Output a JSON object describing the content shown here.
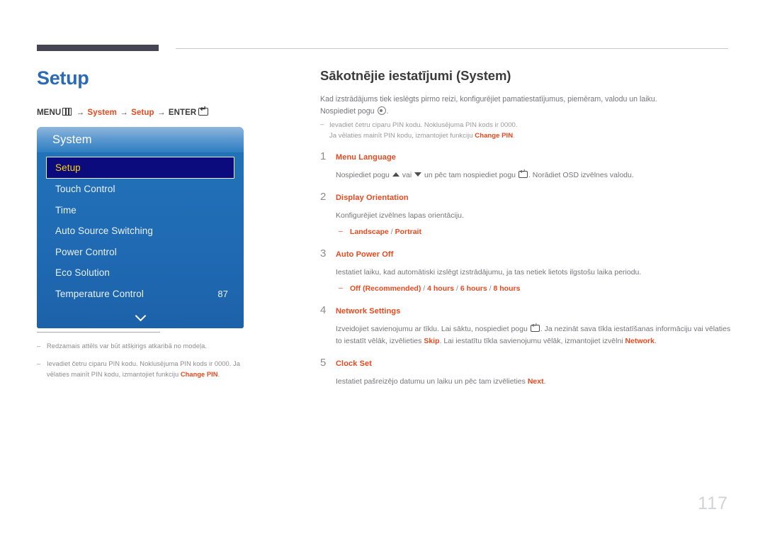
{
  "header": {
    "rule_color": "#454553"
  },
  "left": {
    "page_title": "Setup",
    "breadcrumb": {
      "menu_label": "MENU",
      "menu_icon": "menu-grid-icon",
      "arrow": "→",
      "system_label": "System",
      "setup_label": "Setup",
      "enter_label": "ENTER",
      "enter_icon": "enter-key-icon"
    },
    "osd": {
      "title": "System",
      "items": [
        {
          "label": "Setup",
          "value": "",
          "selected": true
        },
        {
          "label": "Touch Control",
          "value": "",
          "selected": false
        },
        {
          "label": "Time",
          "value": "",
          "selected": false
        },
        {
          "label": "Auto Source Switching",
          "value": "",
          "selected": false
        },
        {
          "label": "Power Control",
          "value": "",
          "selected": false
        },
        {
          "label": "Eco Solution",
          "value": "",
          "selected": false
        },
        {
          "label": "Temperature Control",
          "value": "87",
          "selected": false
        }
      ],
      "scroll_icon": "chevron-down-icon",
      "selected_text_color": "#fbd307",
      "selected_bg_color": "#0b0b7d",
      "panel_color": "#1f6ab4"
    },
    "footnotes": [
      {
        "dash": "–",
        "text": "Redzamais attēls var būt atšķirigs atkaribā no modeļa.",
        "highlight": "",
        "text_after": ""
      },
      {
        "dash": "–",
        "text": "Ievadiet četru ciparu PIN kodu. Noklusējuma PIN kods ir 0000. Ja vēlaties mainīt PIN kodu, izmantojiet funkciju ",
        "highlight": "Change PIN",
        "text_after": "."
      }
    ]
  },
  "right": {
    "section_title": "Sākotnējie iestatījumi (System)",
    "intro_line1": "Kad izstrādājums tiek ieslēgts pirmo reizi, konfigurējiet pamatiestatījumus, piemēram, valodu un laiku.",
    "intro_line2_before": "Nospiediet pogu ",
    "intro_line2_icon": "select-circle-icon",
    "intro_line2_after": ".",
    "note": {
      "dash": "–",
      "line1": "Ievadiet četru ciparu PIN kodu. Noklusējuma PIN kods ir 0000.",
      "line2_before": "Ja vēlaties mainīt PIN kodu, izmantojiet funkciju ",
      "line2_highlight": "Change PIN",
      "line2_after": "."
    },
    "steps": [
      {
        "num": "1",
        "title": "Menu Language",
        "body_before": "Nospiediet pogu ",
        "body_mid": " vai ",
        "body_after": " un pēc tam nospiediet pogu ",
        "body_end": ". Norādiet OSD izvēlnes valodu.",
        "options": []
      },
      {
        "num": "2",
        "title": "Display Orientation",
        "body_plain": "Konfigurējiet izvēlnes lapas orientāciju.",
        "options": [
          {
            "dash": "–",
            "parts": [
              "Landscape",
              "/",
              "Portrait"
            ]
          }
        ]
      },
      {
        "num": "3",
        "title": "Auto Power Off",
        "body_plain": "Iestatiet laiku, kad automātiski izslēgt izstrādājumu, ja tas netiek lietots ilgstošu laika periodu.",
        "options": [
          {
            "dash": "–",
            "parts": [
              "Off (Recommended)",
              "/",
              "4 hours",
              "/",
              "6 hours",
              "/",
              "8 hours"
            ]
          }
        ]
      },
      {
        "num": "4",
        "title": "Network Settings",
        "body_before": "Izveidojiet savienojumu ar tīklu. Lai sāktu, nospiediet pogu ",
        "body_after": ". Ja nezināt sava tīkla iestatīšanas informāciju vai vēlaties to iestatīt vēlāk, izvēlieties ",
        "highlight1": "Skip",
        "body_mid2": ". Lai iestatītu tīkla savienojumu vēlāk, izmantojiet izvēlni ",
        "highlight2": "Network",
        "body_end": ".",
        "options": []
      },
      {
        "num": "5",
        "title": "Clock Set",
        "body_before": "Iestatiet pašreizējo datumu un laiku un pēc tam izvēlieties ",
        "highlight1": "Next",
        "body_end": ".",
        "options": []
      }
    ]
  },
  "page_number": "117"
}
